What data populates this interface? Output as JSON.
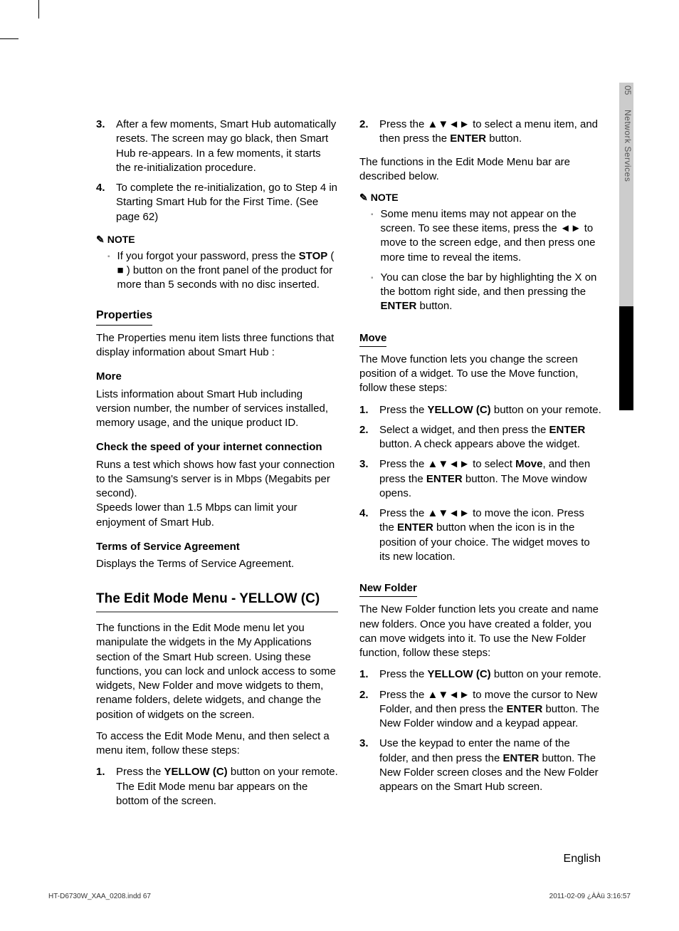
{
  "sideTab": {
    "num": "05",
    "label": "Network Services"
  },
  "left": {
    "ol1": [
      {
        "n": "3.",
        "t": "After a few moments, Smart Hub automatically resets. The screen may go black, then Smart Hub re-appears. In a few moments, it starts the re-initialization procedure."
      },
      {
        "n": "4.",
        "t": "To complete the re-initialization, go to Step 4 in Starting Smart Hub for the First Time. (See page 62)"
      }
    ],
    "noteLabel": "NOTE",
    "note1_a": "If you forgot your password, press the ",
    "note1_b": "STOP",
    "note1_c": " ( ■ ) button on the front panel of the product for more than 5 seconds with no disc inserted.",
    "propsHead": "Properties",
    "propsBody": "The Properties menu item lists three functions that display information about Smart Hub :",
    "moreHead": "More",
    "moreBody": "Lists information about Smart Hub including version number, the number of services installed, memory usage, and the unique product ID.",
    "speedHead": "Check the speed of your internet connection",
    "speedBody1": "Runs a test which shows how fast your connection to the Samsung's server is in Mbps (Megabits per second).",
    "speedBody2": "Speeds lower than 1.5 Mbps can limit your enjoyment of Smart Hub.",
    "tosHead": "Terms of Service Agreement",
    "tosBody": "Displays the Terms of Service Agreement.",
    "editHead": "The Edit Mode Menu - YELLOW (C)",
    "editBody1": "The functions in the Edit Mode menu let you manipulate the widgets in the My Applications section of the Smart Hub screen. Using these functions, you can lock and unlock access to some widgets, New Folder and move widgets to them, rename folders, delete widgets, and change the position of widgets on the screen.",
    "editBody2": "To access the Edit Mode Menu, and then select a menu item, follow these steps:",
    "ol2_n": "1.",
    "ol2_a": "Press the ",
    "ol2_b": "YELLOW (C)",
    "ol2_c": " button on your remote. The Edit Mode menu bar appears on the bottom of the screen."
  },
  "right": {
    "ol1_n": "2.",
    "ol1_a": "Press the ▲▼◄► to select a menu item, and then press the ",
    "ol1_b": "ENTER",
    "ol1_c": " button.",
    "intro": "The functions in the Edit Mode Menu bar are described below.",
    "noteLabel": "NOTE",
    "note1": "Some menu items may not appear on the screen. To see these items, press the ◄► to move to the screen edge, and then press one more time to reveal the items.",
    "note2_a": "You can close the bar by highlighting the X on the bottom right side, and then pressing the ",
    "note2_b": "ENTER",
    "note2_c": " button.",
    "moveHead": "Move",
    "moveBody": "The Move function lets you change the screen position of a widget. To use the Move function, follow these steps:",
    "mol1_n": "1.",
    "mol1_a": "Press the ",
    "mol1_b": "YELLOW (C)",
    "mol1_c": " button on your remote.",
    "mol2_n": "2.",
    "mol2_a": "Select a widget, and then press the ",
    "mol2_b": "ENTER",
    "mol2_c": " button. A check appears above the widget.",
    "mol3_n": "3.",
    "mol3_a": "Press the ▲▼◄► to select ",
    "mol3_b": "Move",
    "mol3_c": ", and then press the ",
    "mol3_d": "ENTER",
    "mol3_e": " button. The Move window opens.",
    "mol4_n": "4.",
    "mol4_a": "Press the ▲▼◄► to move the icon. Press the ",
    "mol4_b": "ENTER",
    "mol4_c": " button when the icon is in the position of your choice. The widget moves to its new location.",
    "nfHead": "New Folder",
    "nfBody": "The New Folder function lets you create and name new folders. Once you have created a folder, you can move widgets into it. To use the New Folder function, follow these steps:",
    "nol1_n": "1.",
    "nol1_a": "Press the ",
    "nol1_b": "YELLOW (C)",
    "nol1_c": " button on your remote.",
    "nol2_n": "2.",
    "nol2_a": "Press the ▲▼◄► to move the cursor to New Folder, and then press the ",
    "nol2_b": "ENTER",
    "nol2_c": " button. The New Folder window and a keypad appear.",
    "nol3_n": "3.",
    "nol3_a": "Use the keypad to enter the name of the folder, and then press the ",
    "nol3_b": "ENTER",
    "nol3_c": " button. The New Folder screen closes and the New Folder appears on the Smart Hub screen."
  },
  "footer": {
    "lang": "English",
    "indd": "HT-D6730W_XAA_0208.indd   67",
    "ts": "2011-02-09   ¿ÀÀü 3:16:57"
  }
}
